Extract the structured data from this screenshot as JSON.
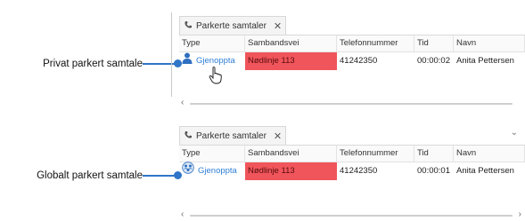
{
  "callouts": {
    "private": "Privat parkert samtale",
    "global": "Globalt parkert samtale"
  },
  "panels": [
    {
      "tab_label": "Parkerte samtaler",
      "tab_close": "✕",
      "columns": [
        "Type",
        "Sambandsvei",
        "Telefonnummer",
        "Tid",
        "Navn"
      ],
      "row": {
        "type_icon": "person-icon",
        "action": "Gjenoppta",
        "route": "Nødlinje 113",
        "phone": "41242350",
        "time": "00:00:02",
        "name": "Anita Pettersen"
      }
    },
    {
      "tab_label": "Parkerte samtaler",
      "tab_close": "✕",
      "columns": [
        "Type",
        "Sambandsvei",
        "Telefonnummer",
        "Tid",
        "Navn"
      ],
      "row": {
        "type_icon": "group-network-icon",
        "action": "Gjenoppta",
        "route": "Nødlinje 113",
        "phone": "41242350",
        "time": "00:00:01",
        "name": "Anita Pettersen"
      }
    }
  ],
  "colors": {
    "accent": "#2f75c8",
    "route_highlight": "#f0555b",
    "link": "#2f7fd6"
  }
}
